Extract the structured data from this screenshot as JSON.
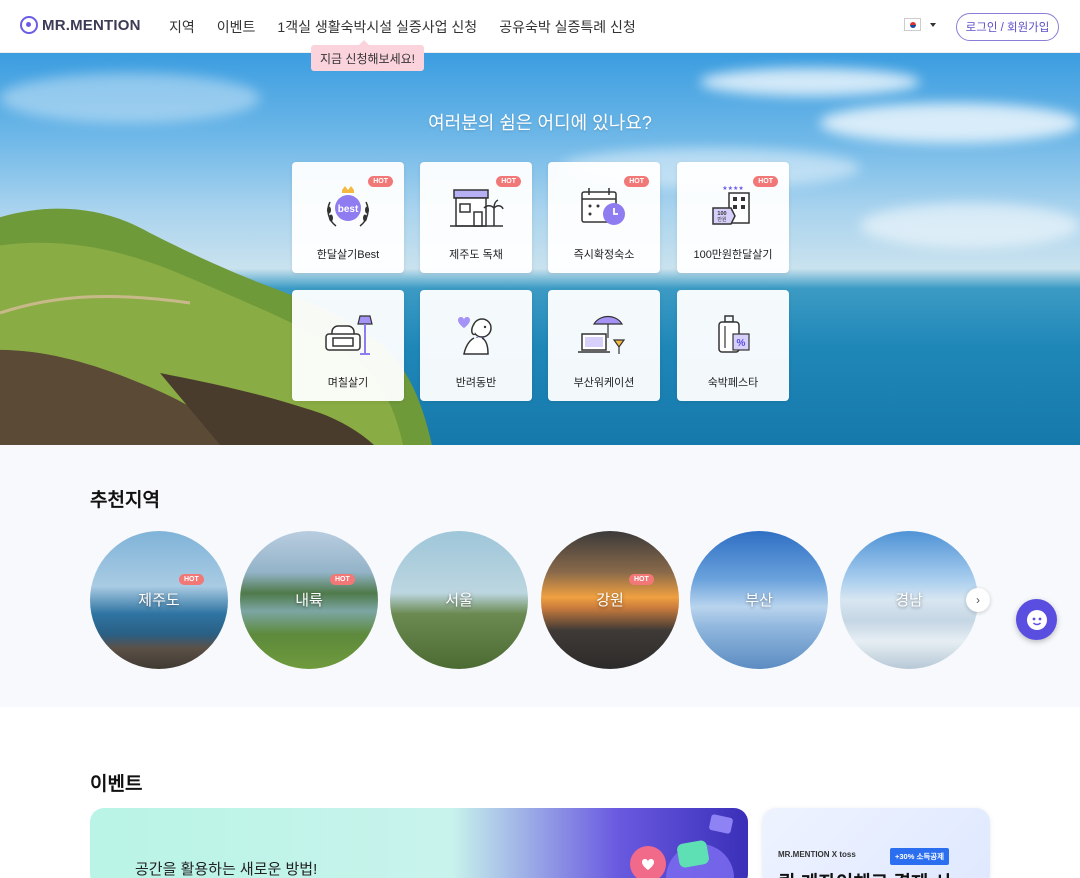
{
  "header": {
    "logo_text": "MR.MENTION",
    "nav": [
      "지역",
      "이벤트",
      "1객실 생활숙박시설 실증사업 신청",
      "공유숙박 실증특례 신청"
    ],
    "login_label": "로그인 / 회원가입"
  },
  "tooltip": "지금 신청해보세요!",
  "hero": {
    "title": "여러분의 쉼은 어디에 있나요?",
    "categories": [
      {
        "label": "한달살기Best",
        "icon": "best-laurel-icon",
        "hot": "HOT"
      },
      {
        "label": "제주도 독채",
        "icon": "house-palm-icon",
        "hot": "HOT"
      },
      {
        "label": "즉시확정숙소",
        "icon": "calendar-clock-icon",
        "hot": "HOT"
      },
      {
        "label": "100만원한달살기",
        "icon": "hotel-price-tag-icon",
        "hot": "HOT"
      },
      {
        "label": "며칠살기",
        "icon": "armchair-lamp-icon"
      },
      {
        "label": "반려동반",
        "icon": "dog-heart-icon"
      },
      {
        "label": "부산워케이션",
        "icon": "laptop-umbrella-icon"
      },
      {
        "label": "숙박페스타",
        "icon": "luggage-discount-icon"
      }
    ]
  },
  "regions": {
    "title": "추천지역",
    "items": [
      {
        "name": "제주도",
        "hot": "HOT"
      },
      {
        "name": "내륙",
        "hot": "HOT"
      },
      {
        "name": "서울"
      },
      {
        "name": "강원",
        "hot": "HOT"
      },
      {
        "name": "부산"
      },
      {
        "name": "경남"
      }
    ]
  },
  "events": {
    "title": "이벤트",
    "main_banner_text": "공간을 활용하는 새로운 방법!",
    "side_banner": {
      "brand": "MR.MENTION X toss",
      "badge": "+30% 소득공제",
      "headline": "퀵 계좌이체로 결제 시"
    }
  }
}
